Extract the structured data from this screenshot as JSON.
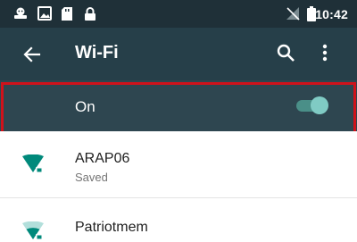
{
  "status_bar": {
    "time": "10:42",
    "left_icons": [
      "android-icon",
      "image-icon",
      "sd-card-icon",
      "lock-icon"
    ],
    "right_icons": [
      "no-signal-icon",
      "battery-icon"
    ]
  },
  "toolbar": {
    "back_icon": "arrow-left-icon",
    "title": "Wi-Fi",
    "search_icon": "search-icon",
    "more_icon": "more-vert-icon"
  },
  "master_switch": {
    "label": "On",
    "state": "on"
  },
  "networks": [
    {
      "name": "ARAP06",
      "status": "Saved",
      "secured": true,
      "signal_level": 1.0
    },
    {
      "name": "Patriotmem",
      "status": "",
      "secured": true,
      "signal_level": 0.5
    }
  ],
  "colors": {
    "status_bar": "#1f3038",
    "toolbar": "#263f49",
    "switch_row": "#2e4650",
    "accent": "#009688",
    "toggle_thumb": "#80cbc4",
    "highlight": "#d0121b"
  }
}
